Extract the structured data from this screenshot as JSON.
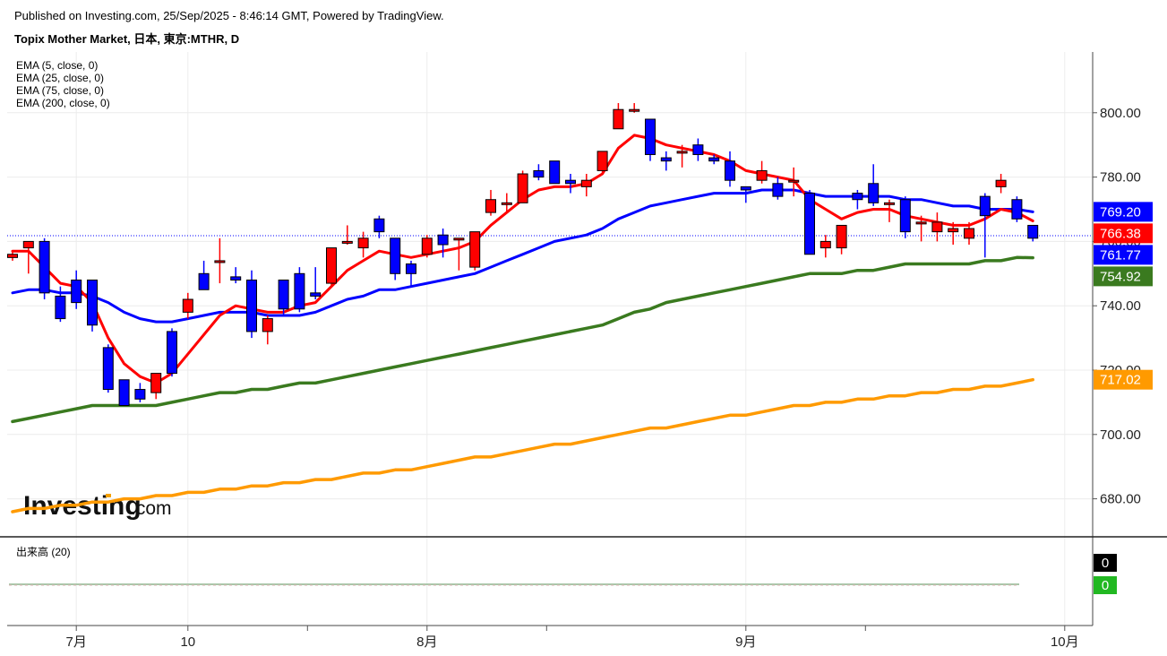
{
  "header": {
    "published": "Published on Investing.com, 25/Sep/2025 - 8:46:14 GMT, Powered by TradingView.",
    "title": "Topix Mother Market, 日本, 東京:MTHR, D"
  },
  "legend": {
    "ema": [
      "EMA (5, close, 0)",
      "EMA (25, close, 0)",
      "EMA (75, close, 0)",
      "EMA (200, close, 0)"
    ],
    "volume": "出来高 (20)"
  },
  "logo": {
    "main": "Investing",
    "suffix": ".com"
  },
  "colors": {
    "up": "#ff0000",
    "down": "#0000ff",
    "ema5": "#ff0000",
    "ema25": "#0000ff",
    "ema75": "#3a7a1f",
    "ema200": "#ff9a00",
    "volume_badge": "#22b822"
  },
  "chart_data": {
    "type": "candlestick",
    "y_ticks": [
      "680.00",
      "700.00",
      "720.00",
      "740.00",
      "760.00",
      "780.00",
      "800.00"
    ],
    "ylim": [
      672,
      820
    ],
    "x_labels": [
      {
        "label": "7月",
        "index": 4
      },
      {
        "label": "10",
        "index": 11
      },
      {
        "label": "8月",
        "index": 26
      },
      {
        "label": "9月",
        "index": 46
      },
      {
        "label": "10月",
        "index": 66
      }
    ],
    "x_minor_ticks": [
      18.5,
      33.5,
      53.5
    ],
    "candles": [
      [
        755,
        757,
        754,
        756
      ],
      [
        758,
        760,
        750,
        760
      ],
      [
        760,
        761,
        742,
        744
      ],
      [
        743,
        746,
        735,
        736
      ],
      [
        748,
        751,
        739,
        741
      ],
      [
        748,
        748,
        732,
        734
      ],
      [
        727,
        728,
        713,
        714
      ],
      [
        717,
        717,
        709,
        709
      ],
      [
        714,
        716,
        710,
        711
      ],
      [
        713,
        719,
        711,
        719
      ],
      [
        732,
        733,
        718,
        719
      ],
      [
        738,
        744,
        736,
        742
      ],
      [
        750,
        754,
        745,
        745
      ],
      [
        754,
        761,
        747,
        754
      ],
      [
        749,
        752,
        747,
        748
      ],
      [
        748,
        751,
        730,
        732
      ],
      [
        732,
        737,
        728,
        736
      ],
      [
        748,
        748,
        737,
        739
      ],
      [
        750,
        752,
        738,
        739
      ],
      [
        744,
        752,
        742,
        743
      ],
      [
        747,
        758,
        746,
        758
      ],
      [
        760,
        765,
        759,
        760
      ],
      [
        758,
        763,
        755,
        761
      ],
      [
        767,
        768,
        761,
        763
      ],
      [
        761,
        761,
        748,
        750
      ],
      [
        753,
        754,
        746,
        750
      ],
      [
        756,
        762,
        755,
        761
      ],
      [
        762,
        764,
        755,
        759
      ],
      [
        761,
        761,
        751,
        761
      ],
      [
        752,
        763,
        751,
        763
      ],
      [
        769,
        776,
        768,
        773
      ],
      [
        772,
        775,
        769,
        772
      ],
      [
        772,
        782,
        772,
        781
      ],
      [
        782,
        784,
        779,
        780
      ],
      [
        785,
        785,
        778,
        778
      ],
      [
        779,
        781,
        775,
        778
      ],
      [
        777,
        781,
        774,
        779
      ],
      [
        782,
        788,
        781,
        788
      ],
      [
        795,
        803,
        795,
        801
      ],
      [
        801,
        803,
        800,
        801
      ],
      [
        798,
        798,
        785,
        787
      ],
      [
        786,
        788,
        782,
        785
      ],
      [
        788,
        790,
        783,
        788
      ],
      [
        790,
        792,
        785,
        787
      ],
      [
        786,
        787,
        784,
        785
      ],
      [
        785,
        788,
        777,
        779
      ],
      [
        777,
        777,
        772,
        776
      ],
      [
        779,
        785,
        778,
        782
      ],
      [
        778,
        780,
        773,
        774
      ],
      [
        779,
        783,
        774,
        779
      ],
      [
        775,
        776,
        756,
        756
      ],
      [
        758,
        762,
        755,
        760
      ],
      [
        758,
        765,
        756,
        765
      ],
      [
        775,
        776,
        770,
        773
      ],
      [
        778,
        784,
        771,
        772
      ],
      [
        772,
        773,
        766,
        772
      ],
      [
        773,
        774,
        761,
        763
      ],
      [
        766,
        768,
        760,
        766
      ],
      [
        763,
        769,
        760,
        766
      ],
      [
        763,
        766,
        759,
        764
      ],
      [
        761,
        766,
        759,
        764
      ],
      [
        774,
        775,
        755,
        768
      ],
      [
        777,
        781,
        775,
        779
      ],
      [
        773,
        774,
        766,
        767
      ],
      [
        765,
        765,
        760,
        761
      ]
    ],
    "ema5": [
      757,
      757,
      752,
      747,
      746,
      741,
      730,
      722,
      718,
      716,
      719,
      725,
      731,
      737,
      740,
      739,
      738,
      738,
      740,
      741,
      746,
      751,
      754,
      757,
      756,
      755,
      756,
      757,
      758,
      760,
      765,
      769,
      773,
      776,
      777,
      777,
      778,
      781,
      789,
      793,
      792,
      790,
      789,
      788,
      787,
      785,
      782,
      781,
      780,
      779,
      773,
      770,
      767,
      769,
      770,
      770,
      768,
      767,
      766,
      765,
      765,
      767,
      770,
      769,
      766.38
    ],
    "ema25": [
      744,
      745,
      745,
      744,
      744,
      743,
      741,
      738,
      736,
      735,
      735,
      736,
      737,
      738,
      738,
      738,
      737,
      737,
      737,
      738,
      740,
      742,
      743,
      745,
      745,
      746,
      747,
      748,
      749,
      750,
      752,
      754,
      756,
      758,
      760,
      761,
      762,
      764,
      767,
      769,
      771,
      772,
      773,
      774,
      775,
      775,
      775,
      776,
      776,
      776,
      775,
      774,
      774,
      774,
      774,
      774,
      773,
      773,
      772,
      771,
      771,
      770,
      770,
      770,
      769.2
    ],
    "ema75": [
      704,
      705,
      706,
      707,
      708,
      709,
      709,
      709,
      709,
      709,
      710,
      711,
      712,
      713,
      713,
      714,
      714,
      715,
      716,
      716,
      717,
      718,
      719,
      720,
      721,
      722,
      723,
      724,
      725,
      726,
      727,
      728,
      729,
      730,
      731,
      732,
      733,
      734,
      736,
      738,
      739,
      741,
      742,
      743,
      744,
      745,
      746,
      747,
      748,
      749,
      750,
      750,
      750,
      751,
      751,
      752,
      753,
      753,
      753,
      753,
      753,
      754,
      754,
      755,
      754.92
    ],
    "ema200": [
      676,
      677,
      677,
      678,
      678,
      679,
      679,
      680,
      680,
      681,
      681,
      682,
      682,
      683,
      683,
      684,
      684,
      685,
      685,
      686,
      686,
      687,
      688,
      688,
      689,
      689,
      690,
      691,
      692,
      693,
      693,
      694,
      695,
      696,
      697,
      697,
      698,
      699,
      700,
      701,
      702,
      702,
      703,
      704,
      705,
      706,
      706,
      707,
      708,
      709,
      709,
      710,
      710,
      711,
      711,
      712,
      712,
      713,
      713,
      714,
      714,
      715,
      715,
      716,
      717.02
    ],
    "last_price": 761.77,
    "price_labels": [
      {
        "value": 769.2,
        "text": "769.20",
        "color": "#0000ff"
      },
      {
        "value": 766.38,
        "text": "766.38",
        "color": "#ff0000"
      },
      {
        "value": 761.77,
        "text": "761.77",
        "color": "#0000ff"
      },
      {
        "value": 754.92,
        "text": "754.92",
        "color": "#3a7a1f"
      },
      {
        "value": 717.02,
        "text": "717.02",
        "color": "#ff9a00"
      }
    ],
    "volume": {
      "badges": [
        "0",
        "0"
      ]
    }
  }
}
